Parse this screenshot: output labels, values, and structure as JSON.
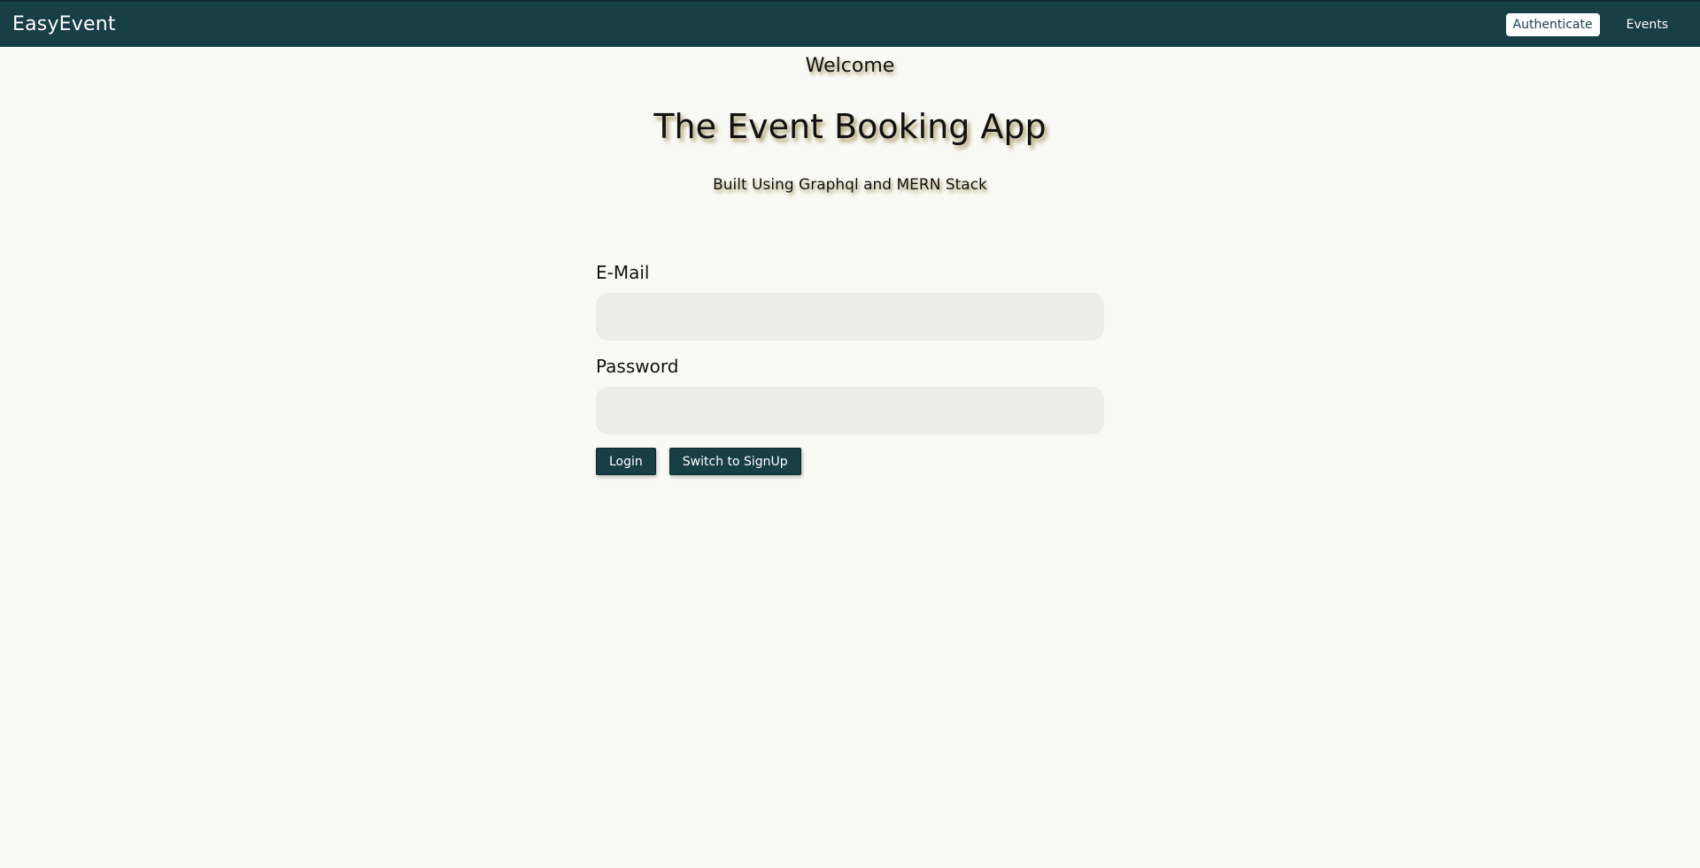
{
  "header": {
    "logo": "EasyEvent",
    "nav": [
      {
        "label": "Authenticate",
        "active": true
      },
      {
        "label": "Events",
        "active": false
      }
    ],
    "background_color": "#183e46"
  },
  "hero": {
    "welcome": "Welcome",
    "title": "The Event Booking App",
    "subtitle": "Built Using Graphql and MERN Stack"
  },
  "form": {
    "email_label": "E-Mail",
    "email_value": "",
    "email_placeholder": "",
    "password_label": "Password",
    "password_value": "",
    "password_placeholder": "",
    "login_label": "Login",
    "switch_label": "Switch to SignUp"
  }
}
